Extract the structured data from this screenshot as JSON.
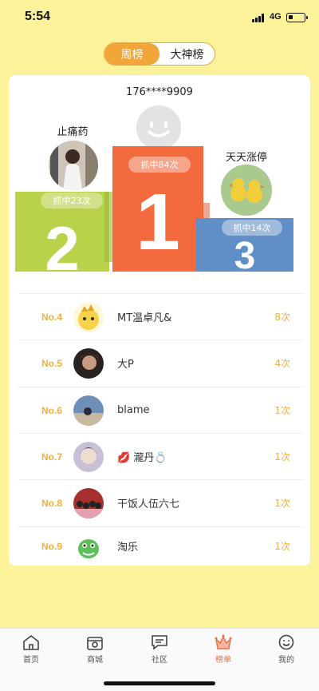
{
  "status": {
    "time": "5:54",
    "network": "4G"
  },
  "toggle": {
    "weekly": "周榜",
    "gods": "大神榜"
  },
  "podium": {
    "first": {
      "name": "176****9909",
      "caught": "抓中84次",
      "rank": "1"
    },
    "second": {
      "name": "止痛药",
      "caught": "抓中23次",
      "rank": "2"
    },
    "third": {
      "name": "天天涨停",
      "caught": "抓中14次",
      "rank": "3"
    }
  },
  "list": [
    {
      "rank": "No.4",
      "name": "MT温卓凡&",
      "count": "8次"
    },
    {
      "rank": "No.5",
      "name": "大P",
      "count": "4次"
    },
    {
      "rank": "No.6",
      "name": "blame",
      "count": "1次"
    },
    {
      "rank": "No.7",
      "name": "💋 瀧丹💍",
      "count": "1次"
    },
    {
      "rank": "No.8",
      "name": "干饭人伍六七",
      "count": "1次"
    },
    {
      "rank": "No.9",
      "name": "淘乐",
      "count": "1次"
    }
  ],
  "tabs": [
    {
      "label": "首页",
      "icon": "home-icon"
    },
    {
      "label": "商城",
      "icon": "shop-icon"
    },
    {
      "label": "社区",
      "icon": "chat-icon"
    },
    {
      "label": "榜单",
      "icon": "crown-icon"
    },
    {
      "label": "我的",
      "icon": "smile-icon"
    }
  ],
  "colors": {
    "background": "#fbf29a",
    "accent": "#f2a63a",
    "first": "#f26a3d",
    "second": "#b8d24a",
    "third": "#5f8fc6",
    "tab_active": "#e8734a"
  }
}
